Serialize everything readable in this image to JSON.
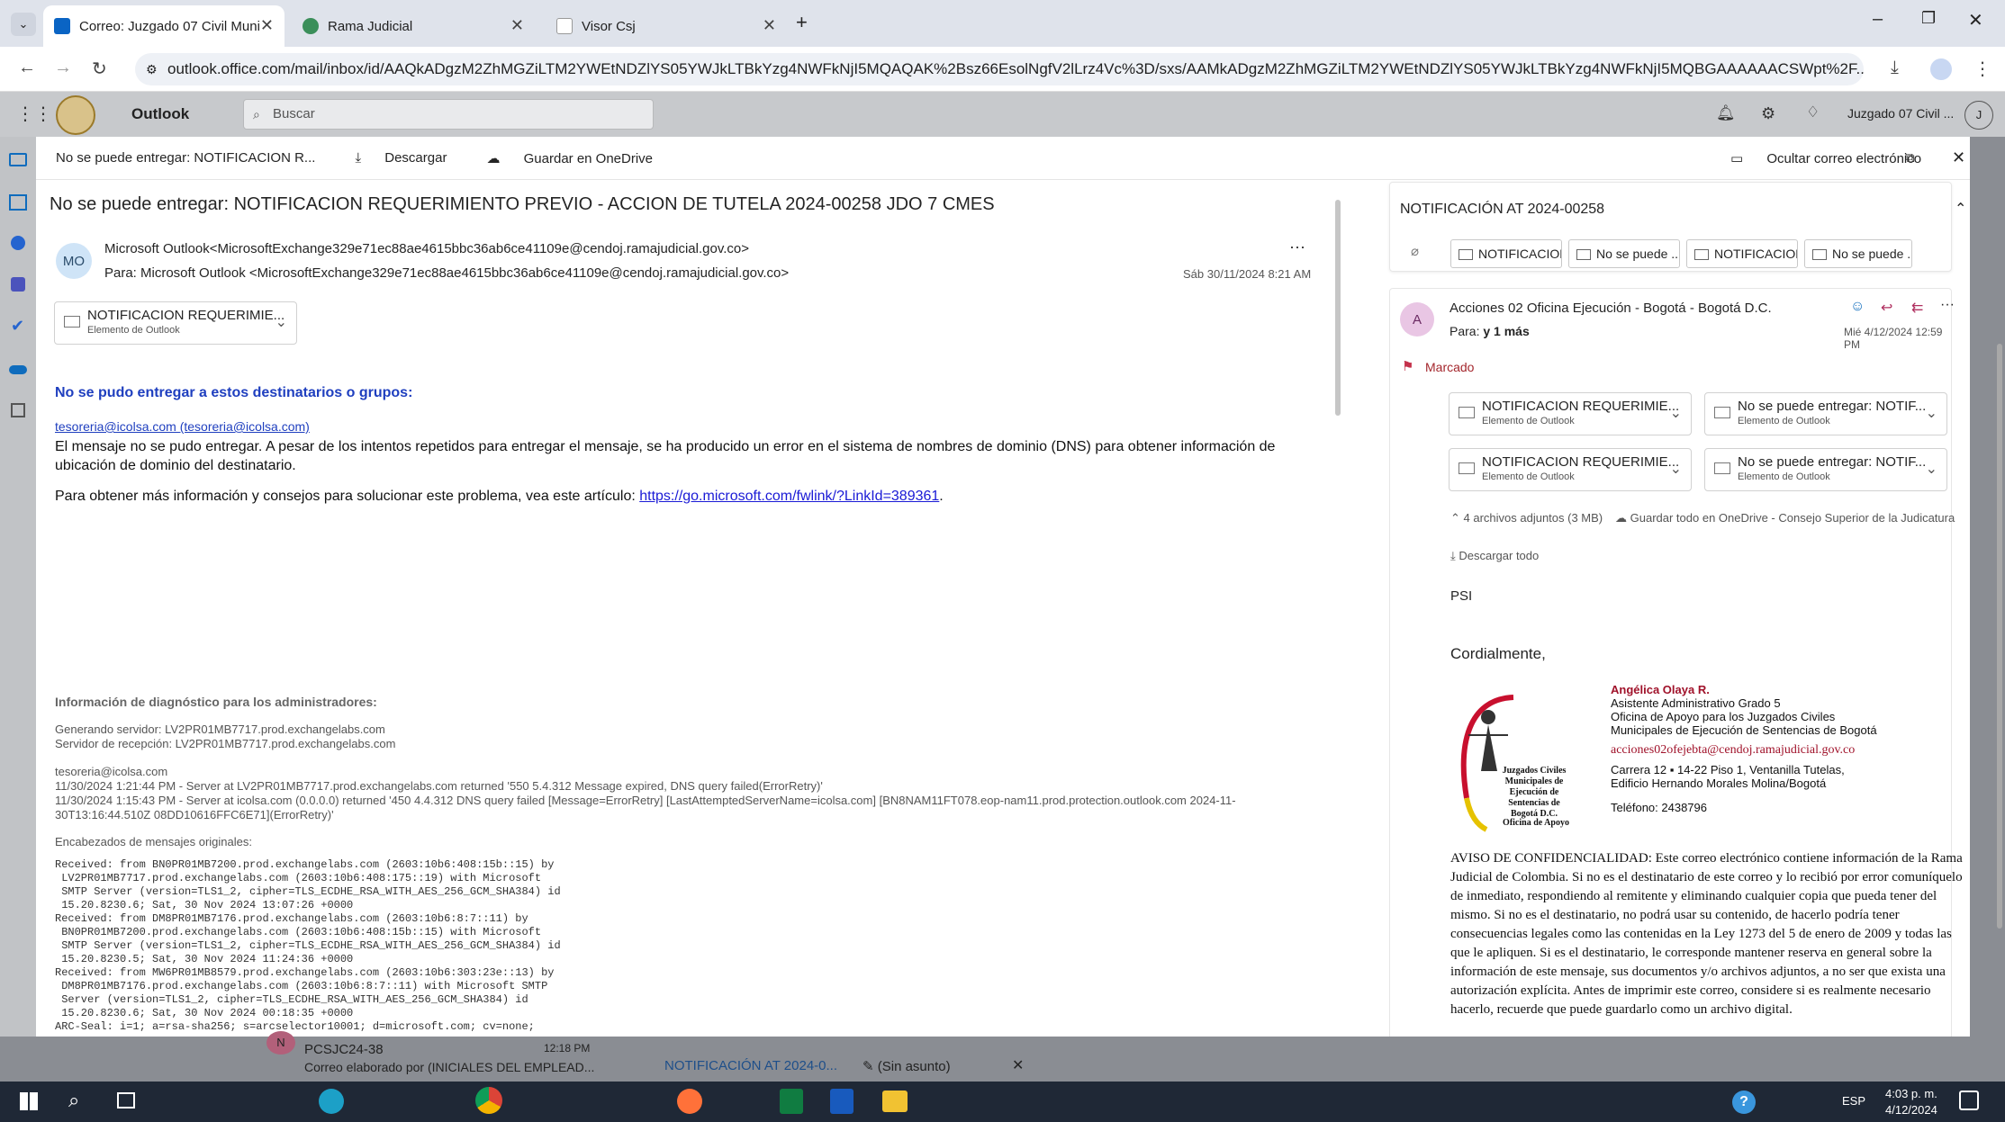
{
  "browser": {
    "tabs": [
      {
        "title": "Correo: Juzgado 07 Civil Munic...",
        "active": true
      },
      {
        "title": "Rama Judicial",
        "active": false
      },
      {
        "title": "Visor Csj",
        "active": false
      }
    ],
    "url": "outlook.office.com/mail/inbox/id/AAQkADgzM2ZhMGZiLTM2YWEtNDZlYS05YWJkLTBkYzg4NWFkNjI5MQAQAK%2Bsz66EsolNgfV2lLrz4Vc%3D/sxs/AAMkADgzM2ZhMGZiLTM2YWEtNDZlYS05YWJkLTBkYzg4NWFkNjI5MQBGAAAAAACSWpt%2F..."
  },
  "outlook": {
    "app_name": "Outlook",
    "search_placeholder": "Buscar",
    "account": "Juzgado 07 Civil ...",
    "account_initial": "J"
  },
  "toolbar": {
    "title": "No se puede entregar: NOTIFICACION R...",
    "download": "Descargar",
    "save_onedrive": "Guardar en OneDrive",
    "hide_email": "Ocultar correo electrónico"
  },
  "message": {
    "subject": "No se puede entregar: NOTIFICACION REQUERIMIENTO PREVIO - ACCION DE TUTELA 2024-00258 JDO 7 CMES",
    "avatar": "MO",
    "from": "Microsoft Outlook<MicrosoftExchange329e71ec88ae4615bbc36ab6ce41109e@cendoj.ramajudicial.gov.co>",
    "to": "Para:  Microsoft Outlook <MicrosoftExchange329e71ec88ae4615bbc36ab6ce41109e@cendoj.ramajudicial.gov.co>",
    "date": "Sáb 30/11/2024 8:21 AM",
    "attachment": {
      "name": "NOTIFICACION REQUERIMIE...",
      "type": "Elemento de Outlook"
    },
    "heading": "No se pudo entregar a estos destinatarios o grupos:",
    "recipient": "tesoreria@icolsa.com (tesoreria@icolsa.com)",
    "error_text": "El mensaje no se pudo entregar. A pesar de los intentos repetidos para entregar el mensaje, se ha producido un error en el sistema de nombres de dominio (DNS) para obtener información de ubicación de dominio del destinatario.",
    "info_text": "Para obtener más información y consejos para solucionar este problema, vea este artículo:",
    "info_link": "https://go.microsoft.com/fwlink/?LinkId=389361",
    "info_end": ".",
    "diag_title": "Información de diagnóstico para los administradores:",
    "diag_server1": "Generando servidor: LV2PR01MB7717.prod.exchangelabs.com",
    "diag_server2": "Servidor de recepción: LV2PR01MB7717.prod.exchangelabs.com",
    "diag_email": "tesoreria@icolsa.com",
    "diag_line1": "11/30/2024 1:21:44 PM - Server at LV2PR01MB7717.prod.exchangelabs.com returned '550 5.4.312 Message expired, DNS query failed(ErrorRetry)'",
    "diag_line2": "11/30/2024 1:15:43 PM - Server at icolsa.com (0.0.0.0) returned '450 4.4.312 DNS query failed [Message=ErrorRetry] [LastAttemptedServerName=icolsa.com] [BN8NAM11FT078.eop-nam11.prod.protection.outlook.com 2024-11-",
    "diag_line3": "30T13:16:44.510Z 08DD10616FFC6E71](ErrorRetry)'",
    "headers_title": "Encabezados de mensajes originales:",
    "headers": "Received: from BN0PR01MB7200.prod.exchangelabs.com (2603:10b6:408:15b::15) by\n LV2PR01MB7717.prod.exchangelabs.com (2603:10b6:408:175::19) with Microsoft\n SMTP Server (version=TLS1_2, cipher=TLS_ECDHE_RSA_WITH_AES_256_GCM_SHA384) id\n 15.20.8230.6; Sat, 30 Nov 2024 13:07:26 +0000\nReceived: from DM8PR01MB7176.prod.exchangelabs.com (2603:10b6:8:7::11) by\n BN0PR01MB7200.prod.exchangelabs.com (2603:10b6:408:15b::15) with Microsoft\n SMTP Server (version=TLS1_2, cipher=TLS_ECDHE_RSA_WITH_AES_256_GCM_SHA384) id\n 15.20.8230.5; Sat, 30 Nov 2024 11:24:36 +0000\nReceived: from MW6PR01MB8579.prod.exchangelabs.com (2603:10b6:303:23e::13) by\n DM8PR01MB7176.prod.exchangelabs.com (2603:10b6:8:7::11) with Microsoft SMTP\n Server (version=TLS1_2, cipher=TLS_ECDHE_RSA_WITH_AES_256_GCM_SHA384) id\n 15.20.8230.6; Sat, 30 Nov 2024 00:18:35 +0000\nARC-Seal: i=1; a=rsa-sha256; s=arcselector10001; d=microsoft.com; cv=none;"
  },
  "right": {
    "thread_title": "NOTIFICACIÓN AT 2024-00258",
    "chips": [
      "NOTIFICACION...",
      "No se puede ...",
      "NOTIFICACION...",
      "No se puede ..."
    ],
    "avatar": "A",
    "sender": "Acciones 02 Oficina Ejecución - Bogotá - Bogotá D.C.",
    "to_label": "Para:",
    "to_value": "y 1 más",
    "date": "Mié 4/12/2024 12:59 PM",
    "flag": "Marcado",
    "attachments": [
      {
        "name": "NOTIFICACION REQUERIMIE...",
        "type": "Elemento de Outlook"
      },
      {
        "name": "No se puede entregar: NOTIF...",
        "type": "Elemento de Outlook"
      },
      {
        "name": "NOTIFICACION REQUERIMIE...",
        "type": "Elemento de Outlook"
      },
      {
        "name": "No se puede entregar: NOTIF...",
        "type": "Elemento de Outlook"
      }
    ],
    "attach_count": "4 archivos adjuntos (3 MB)",
    "save_all": "Guardar todo en OneDrive - Consejo Superior de la Judicatura",
    "download_all": "Descargar todo",
    "psi": "PSI",
    "regards": "Cordialmente,",
    "sig_name": "Angélica Olaya R.",
    "sig_l1": "Asistente Administrativo Grado 5",
    "sig_l2": "Oficina de Apoyo para los Juzgados Civiles",
    "sig_l3": "Municipales de Ejecución de Sentencias de Bogotá",
    "sig_email": "acciones02ofejebta@cendoj.ramajudicial.gov.co",
    "sig_addr1": "Carrera 12 ▪ 14-22 Piso 1, Ventanilla Tutelas,",
    "sig_addr2": "Edificio Hernando Morales Molina/Bogotá",
    "sig_tel": "Teléfono: 2438796",
    "logo_text": "Juzgados Civiles Municipales de Ejecución de Sentencias de Bogotá D.C.",
    "logo_text2": "Oficina de Apoyo",
    "notice": "AVISO DE CONFIDENCIALIDAD: Este correo electrónico contiene información de la Rama Judicial de Colombia. Si no es el destinatario de este correo y lo recibió por error comuníquelo de inmediato, respondiendo al remitente y eliminando cualquier copia que pueda tener del mismo. Si no es el destinatario, no podrá usar su contenido, de hacerlo podría tener consecuencias legales como las contenidas en la Ley 1273 del 5 de enero de 2009 y todas las que le apliquen. Si es el destinatario, le corresponde mantener reserva en general sobre la información de este mensaje, sus documentos y/o archivos adjuntos, a no ser que exista una autorización explícita. Antes de imprimir este correo, considere si es realmente necesario hacerlo, recuerde que puede guardarlo como un archivo digital."
  },
  "background": {
    "item_initial": "N",
    "item_title": "PCSJC24-38",
    "item_time": "12:18 PM",
    "item_preview": "Correo elaborado por (INICIALES DEL EMPLEAD...",
    "draft_tab": "NOTIFICACIÓN AT 2024-0...",
    "draft_tab2": "(Sin asunto)"
  },
  "taskbar": {
    "lang": "ESP",
    "time": "4:03 p. m.",
    "date": "4/12/2024"
  }
}
